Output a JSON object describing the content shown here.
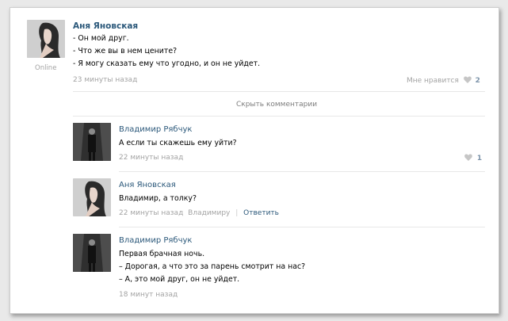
{
  "post": {
    "author": "Аня Яновская",
    "status": "Online",
    "lines": [
      "- Он мой друг.",
      "- Что же вы в нем цените?",
      "- Я могу сказать ему что угодно, и он не уйдет."
    ],
    "time": "23 минуты назад",
    "likes_label": "Мне нравится",
    "likes_count": "2"
  },
  "hide_comments": "Скрыть комментарии",
  "comments": [
    {
      "author": "Владимир Рябчук",
      "lines": [
        "А если ты скажешь ему уйти?"
      ],
      "time": "22 минуты назад",
      "likes_count": "1"
    },
    {
      "author": "Аня Яновская",
      "lines": [
        "Владимир, а толку?"
      ],
      "time": "22 минуты назад",
      "reply_to": "Владимиру",
      "reply_label": "Ответить"
    },
    {
      "author": "Владимир Рябчук",
      "lines": [
        "Первая брачная ночь.",
        "– Дорогая, а что это за парень смотрит на нас?",
        "– А, это мой друг, он не уйдет."
      ],
      "time": "18 минут назад"
    }
  ],
  "colors": {
    "link": "#2b587a",
    "meta": "#a3a3a3",
    "heart": "#c6c6c6"
  }
}
